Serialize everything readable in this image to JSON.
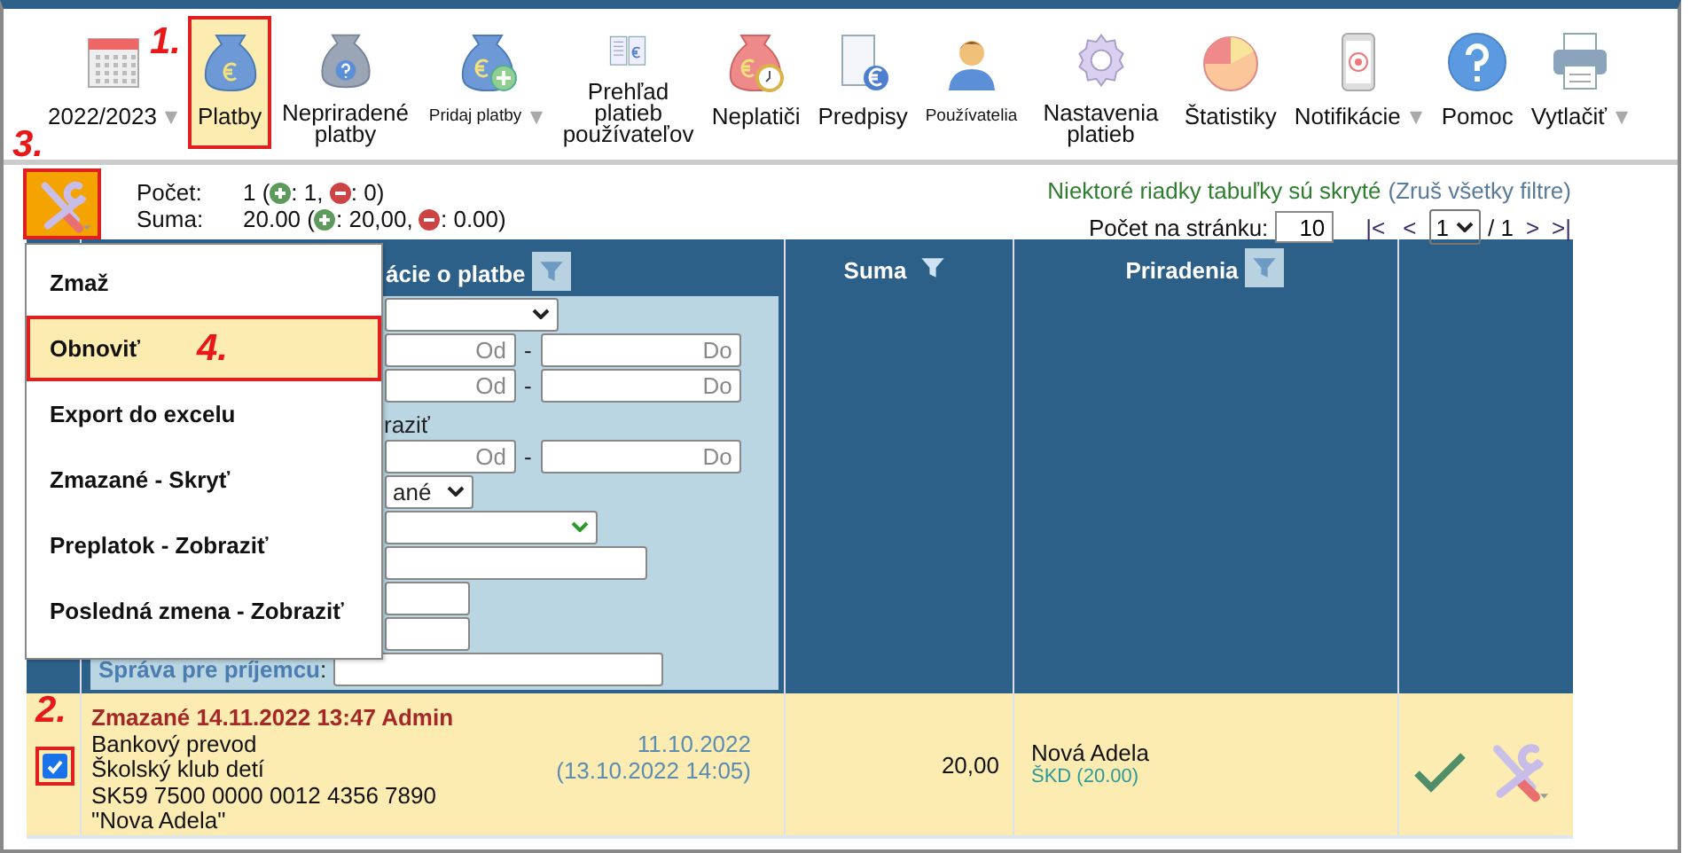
{
  "toolbar": [
    {
      "label": "2022/2023",
      "dropdown": true,
      "selected": false,
      "compact": false
    },
    {
      "label": "Platby",
      "dropdown": false,
      "selected": true,
      "compact": false,
      "outlined": true,
      "marker": "1."
    },
    {
      "label": "Nepriradené platby",
      "dropdown": false,
      "selected": false,
      "compact": false
    },
    {
      "label": "Pridaj platby",
      "dropdown": true,
      "selected": false,
      "compact": true
    },
    {
      "label": "Prehľad platieb používateľov",
      "dropdown": false,
      "selected": false,
      "compact": false
    },
    {
      "label": "Neplatiči",
      "dropdown": false,
      "selected": false,
      "compact": false
    },
    {
      "label": "Predpisy",
      "dropdown": false,
      "selected": false,
      "compact": false
    },
    {
      "label": "Používatelia",
      "dropdown": false,
      "selected": false,
      "compact": true
    },
    {
      "label": "Nastavenia platieb",
      "dropdown": false,
      "selected": false,
      "compact": false
    },
    {
      "label": "Štatistiky",
      "dropdown": false,
      "selected": false,
      "compact": false
    },
    {
      "label": "Notifikácie",
      "dropdown": true,
      "selected": false,
      "compact": false
    },
    {
      "label": "Pomoc",
      "dropdown": false,
      "selected": false,
      "compact": false
    },
    {
      "label": "Vytlačiť",
      "dropdown": true,
      "selected": false,
      "compact": false
    }
  ],
  "tools_button": {
    "outlined": true,
    "marker": "3."
  },
  "stats": [
    {
      "label": "Počet:",
      "total": "1 (",
      "plus": ": 1,",
      "minus": ": 0)"
    },
    {
      "label": "Suma:",
      "total": "20.00 (",
      "plus": ": 20,00,",
      "minus": ": 0.00)"
    }
  ],
  "notice": {
    "text": "Niektoré riadky tabuľky sú skryté",
    "link": "(Zruš všetky filtre)"
  },
  "paging": {
    "label": "Počet na stránku:",
    "per_page": "10",
    "first": "|<",
    "prev": "<",
    "page": "1",
    "total": "/ 1",
    "next": ">",
    "last": ">|"
  },
  "menu": [
    {
      "label": "Zmaž",
      "selected": false
    },
    {
      "label": "Obnoviť",
      "selected": true,
      "outlined": true,
      "marker": "4."
    },
    {
      "label": "Export do excelu",
      "selected": false
    },
    {
      "label": "Zmazané - Skryť",
      "selected": false
    },
    {
      "label": "Preplatok - Zobraziť",
      "selected": false
    },
    {
      "label": "Posledná zmena - Zobraziť",
      "selected": false
    }
  ],
  "table": {
    "columns": [
      {
        "kind": "check"
      },
      {
        "kind": "info",
        "label": "ácie o platbe",
        "filter_active": true
      },
      {
        "kind": "amount",
        "label": "Suma",
        "filter_active": false
      },
      {
        "kind": "assign",
        "label": "Priradenia",
        "filter_active": true
      },
      {
        "kind": "actions"
      }
    ],
    "filters": [
      {
        "kind": "select"
      },
      {
        "kind": "range",
        "from": "Od",
        "separator": "-",
        "to": "Do"
      },
      {
        "kind": "range",
        "from": "Od",
        "separator": "-",
        "to": "Do"
      },
      {
        "kind": "text",
        "text": "raziť"
      },
      {
        "kind": "range",
        "from": "Od",
        "separator": "-",
        "to": "Do"
      },
      {
        "kind": "select",
        "value": "ané"
      },
      {
        "kind": "select",
        "valid": true
      },
      {
        "kind": "input"
      },
      {
        "kind": "input"
      },
      {
        "kind": "input"
      },
      {
        "kind": "labeled",
        "label": "Správa pre príjemcu",
        "colon": ":"
      }
    ],
    "rows": [
      {
        "checked": true,
        "outlined": true,
        "marker": "2.",
        "status": "Zmazané 14.11.2022 13:47 Admin",
        "lines": [
          "Bankový prevod",
          "Školský klub detí",
          "SK59 7500 0000 0012 4356 7890",
          "\"Nova Adela\""
        ],
        "date": "11.10.2022",
        "created": "(13.10.2022 14:05)",
        "amount": "20,00",
        "assignee": "Nová Adela",
        "assignment": "ŠKD (20.00)",
        "approved": true
      }
    ]
  }
}
